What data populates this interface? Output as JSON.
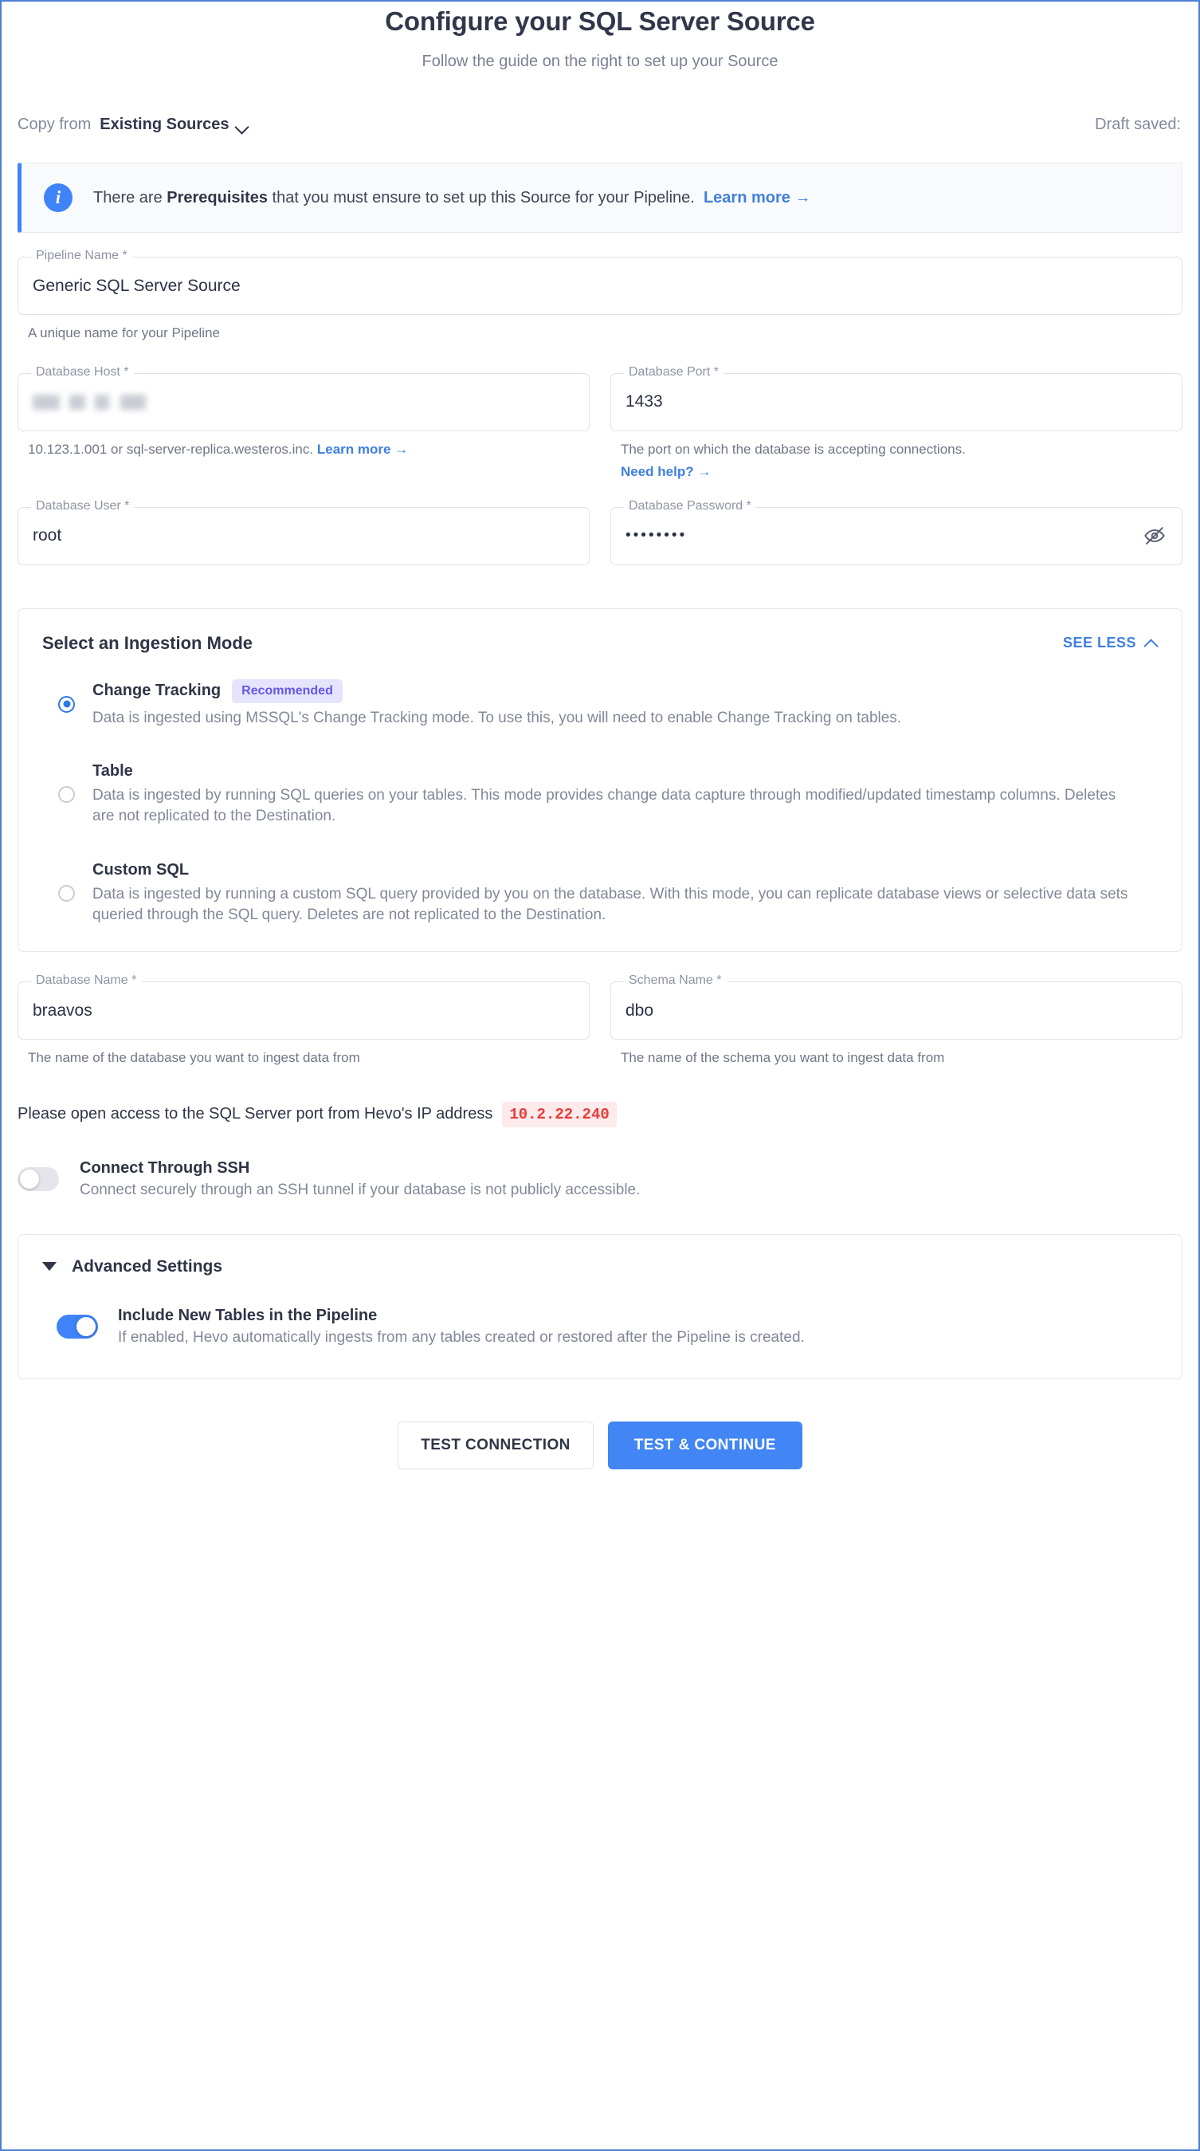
{
  "header": {
    "title": "Configure your SQL Server Source",
    "subtitle": "Follow the guide on the right to set up your Source"
  },
  "copy_from": {
    "label": "Copy from",
    "value": "Existing Sources",
    "chevron_icon": "chevron-down-icon",
    "draft_status": "Draft saved:"
  },
  "prerequisites_banner": {
    "icon": "info-icon",
    "text_before": "There are ",
    "text_bold": "Prerequisites",
    "text_after": " that you must ensure to set up this Source for your Pipeline.",
    "link_label": "Learn more",
    "link_arrow": "→",
    "accent_color": "#3f83f8"
  },
  "fields": {
    "pipeline_name": {
      "label": "Pipeline Name *",
      "value": "Generic SQL Server Source",
      "placeholder": "Pipeline Name",
      "helper": "A unique name for your Pipeline"
    },
    "database_host": {
      "label": "Database Host *",
      "value": "10.0.20.140",
      "redacted": true,
      "placeholder": "Database Host",
      "helper_text": "10.123.1.001 or sql-server-replica.westeros.inc.",
      "helper_link": "Learn more",
      "helper_arrow": "→"
    },
    "database_port": {
      "label": "Database Port *",
      "value": "1433",
      "placeholder": "Database Port",
      "helper_text": "The port on which the database is accepting connections.",
      "helper_link": "Need help?",
      "helper_arrow": "→"
    },
    "database_user": {
      "label": "Database User *",
      "value": "root",
      "placeholder": "Database User"
    },
    "database_password": {
      "label": "Database Password *",
      "value": "••••••••",
      "placeholder": "Database Password",
      "reveal_icon": "eye-off-icon"
    },
    "database_name": {
      "label": "Database Name *",
      "value": "braavos",
      "placeholder": "Database Name",
      "helper": "The name of the database you want to ingest data from"
    },
    "schema_name": {
      "label": "Schema Name *",
      "value": "dbo",
      "placeholder": "Schema Name",
      "helper": "The name of the schema you want to ingest data from"
    }
  },
  "ingestion": {
    "title": "Select an Ingestion Mode",
    "toggle_label": "SEE LESS",
    "toggle_icon": "chevron-up-icon",
    "options": [
      {
        "title": "Change Tracking",
        "badge": "Recommended",
        "description": "Data is ingested using MSSQL's Change Tracking mode. To use this, you will need to enable Change Tracking on tables.",
        "selected": true
      },
      {
        "title": "Table",
        "badge": "",
        "description": "Data is ingested by running SQL queries on your tables. This mode provides change data capture through modified/updated timestamp columns. Deletes are not replicated to the Destination.",
        "selected": false
      },
      {
        "title": "Custom SQL",
        "badge": "",
        "description": "Data is ingested by running a custom SQL query provided by you on the database. With this mode, you can replicate database views or selective data sets queried through the SQL query. Deletes are not replicated to the Destination.",
        "selected": false
      }
    ]
  },
  "ip_note": {
    "text": "Please open access to the SQL Server port from Hevo's IP address",
    "ip": "10.2.22.240",
    "ip_color": "#eb3b3b"
  },
  "ssh": {
    "title": "Connect Through SSH",
    "description": "Connect securely through an SSH tunnel if your database is not publicly accessible.",
    "enabled": false
  },
  "advanced": {
    "title": "Advanced Settings",
    "expand_icon": "triangle-down-icon",
    "include_new_tables": {
      "title": "Include New Tables in the Pipeline",
      "description": "If enabled, Hevo automatically ingests from any tables created or restored after the Pipeline is created.",
      "enabled": true
    }
  },
  "actions": {
    "test_connection": "TEST CONNECTION",
    "test_and_continue": "TEST & CONTINUE",
    "primary_color": "#4285f4"
  }
}
